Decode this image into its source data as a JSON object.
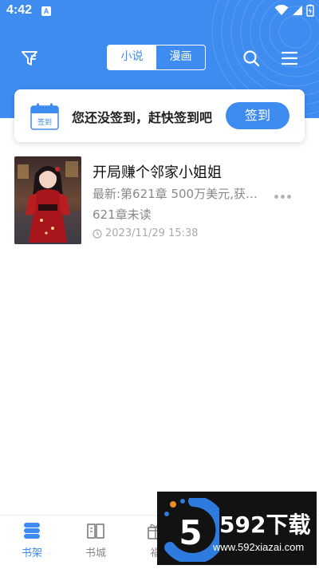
{
  "status_bar": {
    "time": "4:42",
    "notification_letter": "A"
  },
  "header": {
    "tabs": [
      {
        "label": "小说",
        "active": true
      },
      {
        "label": "漫画",
        "active": false
      }
    ],
    "icons": [
      "filter-icon",
      "search-icon",
      "menu-icon"
    ],
    "accent_color": "#3f8cf0"
  },
  "signin": {
    "calendar_label": "签到",
    "prompt": "您还没签到，赶快签到吧",
    "button_label": "签到"
  },
  "books": [
    {
      "title": "开局赚个邻家小姐姐",
      "latest": "最新:第621章 500万美元,获…",
      "unread": "621章未读",
      "updated": "2023/11/29 15:38"
    }
  ],
  "bottom_nav": {
    "items": [
      {
        "label": "书架",
        "icon": "bookshelf-icon",
        "active": true
      },
      {
        "label": "书城",
        "icon": "book-icon",
        "active": false
      },
      {
        "label": "福",
        "icon": "gift-icon",
        "active": false
      }
    ]
  },
  "watermark": {
    "logo_digit": "5",
    "brand": "592下载",
    "url": "www.592xiazai.com"
  }
}
